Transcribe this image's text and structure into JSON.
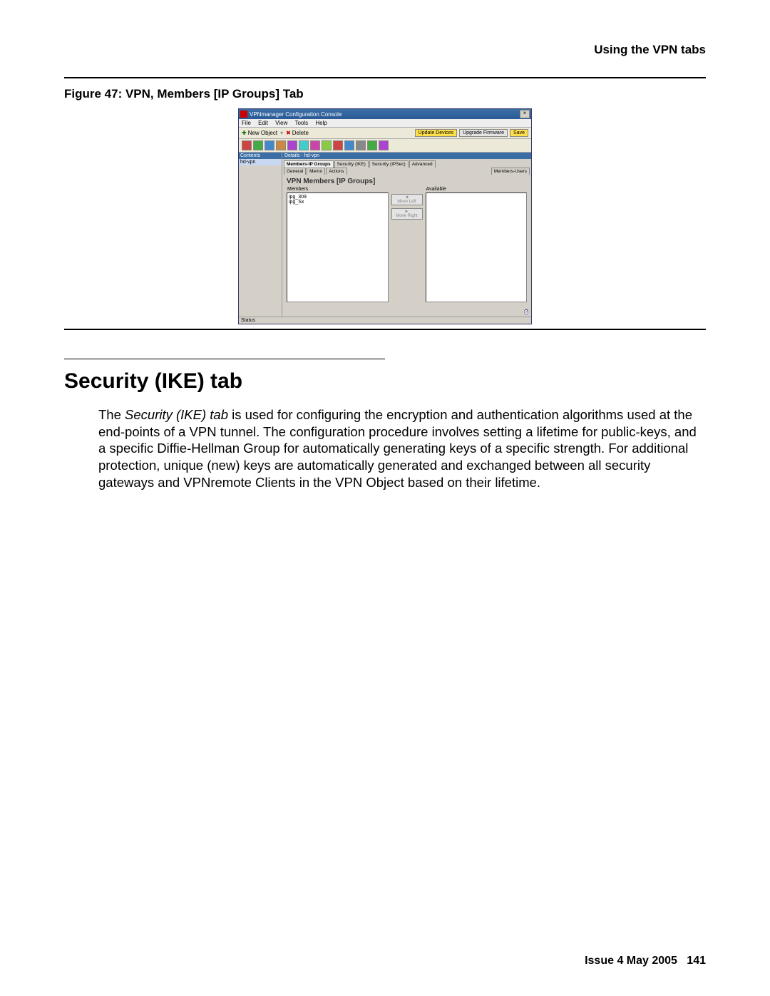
{
  "header": {
    "right": "Using the VPN tabs"
  },
  "figure": {
    "caption": "Figure 47: VPN, Members [IP Groups] Tab"
  },
  "app": {
    "title": "VPNmanager Configuration Console",
    "menus": [
      "File",
      "Edit",
      "View",
      "Tools",
      "Help"
    ],
    "toolbar_text": {
      "new_object": "New Object",
      "delete": "Delete"
    },
    "buttons": {
      "update_devices": "Update Devices",
      "upgrade_firmware": "Upgrade Firmware",
      "save": "Save"
    },
    "sidebar": {
      "header": "Contents",
      "item": "hd-vpn"
    },
    "details": {
      "header": "Details - hd-vpn"
    },
    "tabs_row1": [
      "Members-IP Groups",
      "Security (IKE)",
      "Security (IPSec)",
      "Advanced"
    ],
    "tabs_row2": [
      "General",
      "Memo",
      "Actions",
      "Members-Users"
    ],
    "panel_title": "VPN Members [IP Groups]",
    "members_label": "Members",
    "available_label": "Available",
    "members_list": [
      "ipg_309",
      "ipg_Sx"
    ],
    "move_left": "Move Left",
    "move_right": "Move Right",
    "status": "Status"
  },
  "section": {
    "title": "Security (IKE) tab",
    "para_lead": "The ",
    "para_ital": "Security (IKE) tab",
    "para_rest": " is used for configuring the encryption and authentication algorithms used at the end-points of a VPN tunnel. The configuration procedure involves setting a lifetime for public-keys, and a specific Diffie-Hellman Group for automatically generating keys of a specific strength. For additional protection, unique (new) keys are automatically generated and exchanged between all security gateways and VPNremote Clients in the VPN Object based on their lifetime."
  },
  "footer": {
    "issue": "Issue 4   May 2005",
    "page": "141"
  },
  "icon_colors": [
    "#c44",
    "#4a4",
    "#48c",
    "#c84",
    "#a4c",
    "#4cc",
    "#c4a",
    "#8c4",
    "#c44",
    "#48c",
    "#888",
    "#4a4",
    "#a4c"
  ]
}
